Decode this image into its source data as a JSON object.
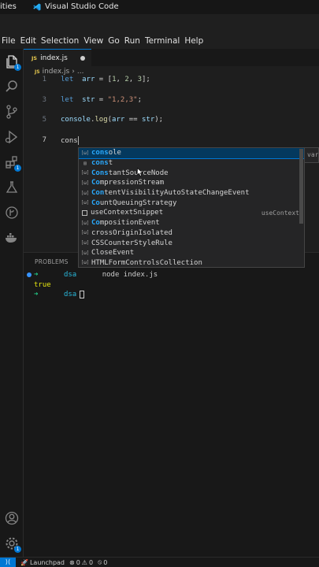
{
  "os_bar": {
    "activities_label": "ities",
    "app_name": "Visual Studio Code"
  },
  "menu": [
    "File",
    "Edit",
    "Selection",
    "View",
    "Go",
    "Run",
    "Terminal",
    "Help"
  ],
  "activity_bar": {
    "explorer_badge": "1",
    "extensions_badge": "1",
    "settings_badge": "1"
  },
  "tab": {
    "icon_text": "JS",
    "filename": "index.js"
  },
  "breadcrumb": {
    "icon_text": "JS",
    "file": "index.js",
    "separator": "›",
    "ellipsis": "..."
  },
  "code_lines": [
    {
      "number": "1",
      "parts": [
        [
          "kw",
          "let"
        ],
        [
          "",
          "  "
        ],
        [
          "var",
          "arr"
        ],
        [
          "",
          " = ["
        ],
        [
          "num",
          "1"
        ],
        [
          "",
          ", "
        ],
        [
          "num",
          "2"
        ],
        [
          "",
          ", "
        ],
        [
          "num",
          "3"
        ],
        [
          "",
          "];"
        ]
      ]
    },
    {
      "number": "",
      "parts": []
    },
    {
      "number": "3",
      "parts": [
        [
          "kw",
          "let"
        ],
        [
          "",
          "  "
        ],
        [
          "var",
          "str"
        ],
        [
          "",
          " = "
        ],
        [
          "str",
          "\"1,2,3\""
        ],
        [
          "",
          ";"
        ]
      ]
    },
    {
      "number": "",
      "parts": []
    },
    {
      "number": "5",
      "parts": [
        [
          "var",
          "console"
        ],
        [
          "",
          "."
        ],
        [
          "fn",
          "log"
        ],
        [
          "",
          "("
        ],
        [
          "var",
          "arr"
        ],
        [
          "",
          " == "
        ],
        [
          "var",
          "str"
        ],
        [
          "",
          ");"
        ]
      ]
    },
    {
      "number": "",
      "parts": []
    },
    {
      "number": "7",
      "parts": [
        [
          "",
          "cons"
        ]
      ]
    }
  ],
  "suggestions": [
    {
      "kind": "[ω]",
      "match": "cons",
      "rest": "ole",
      "detail": "",
      "selected": true
    },
    {
      "kind": "▤",
      "match": "cons",
      "rest": "t",
      "detail": "",
      "selected": false
    },
    {
      "kind": "[ω]",
      "match": "Cons",
      "rest": "tantSourceNode",
      "detail": "",
      "selected": false
    },
    {
      "kind": "[ω]",
      "match": "Co",
      "rest": "mpressionStream",
      "detail": "",
      "selected": false
    },
    {
      "kind": "[ω]",
      "match": "Con",
      "rest": "tentVisibilityAutoStateChangeEvent",
      "detail": "",
      "selected": false
    },
    {
      "kind": "[ω]",
      "match": "Co",
      "rest": "untQueuingStrategy",
      "detail": "",
      "selected": false
    },
    {
      "kind": "snippet",
      "match": "",
      "rest": "useContextSnippet",
      "detail": "useContext",
      "selected": false
    },
    {
      "kind": "[ω]",
      "match": "Co",
      "rest": "mpositionEvent",
      "detail": "",
      "selected": false
    },
    {
      "kind": "[ω]",
      "match": "",
      "rest": "crossOriginIsolated",
      "detail": "",
      "selected": false
    },
    {
      "kind": "[ω]",
      "match": "",
      "rest": "CSSCounterStyleRule",
      "detail": "",
      "selected": false
    },
    {
      "kind": "[ω]",
      "match": "",
      "rest": "CloseEvent",
      "detail": "",
      "selected": false
    },
    {
      "kind": "[ω]",
      "match": "",
      "rest": "HTMLFormControlsCollection",
      "detail": "",
      "selected": false
    }
  ],
  "doc_peek": "var",
  "panel": {
    "tab_label": "PROBLEMS"
  },
  "terminal": {
    "prompt_arrow": "➜",
    "cwd": "dsa",
    "command": "node index.js",
    "output": "true"
  },
  "status_bar": {
    "remote_icon": "⟩⟨",
    "launchpad": "Launchpad",
    "errors": "0",
    "warnings": "0",
    "ports": "0"
  }
}
